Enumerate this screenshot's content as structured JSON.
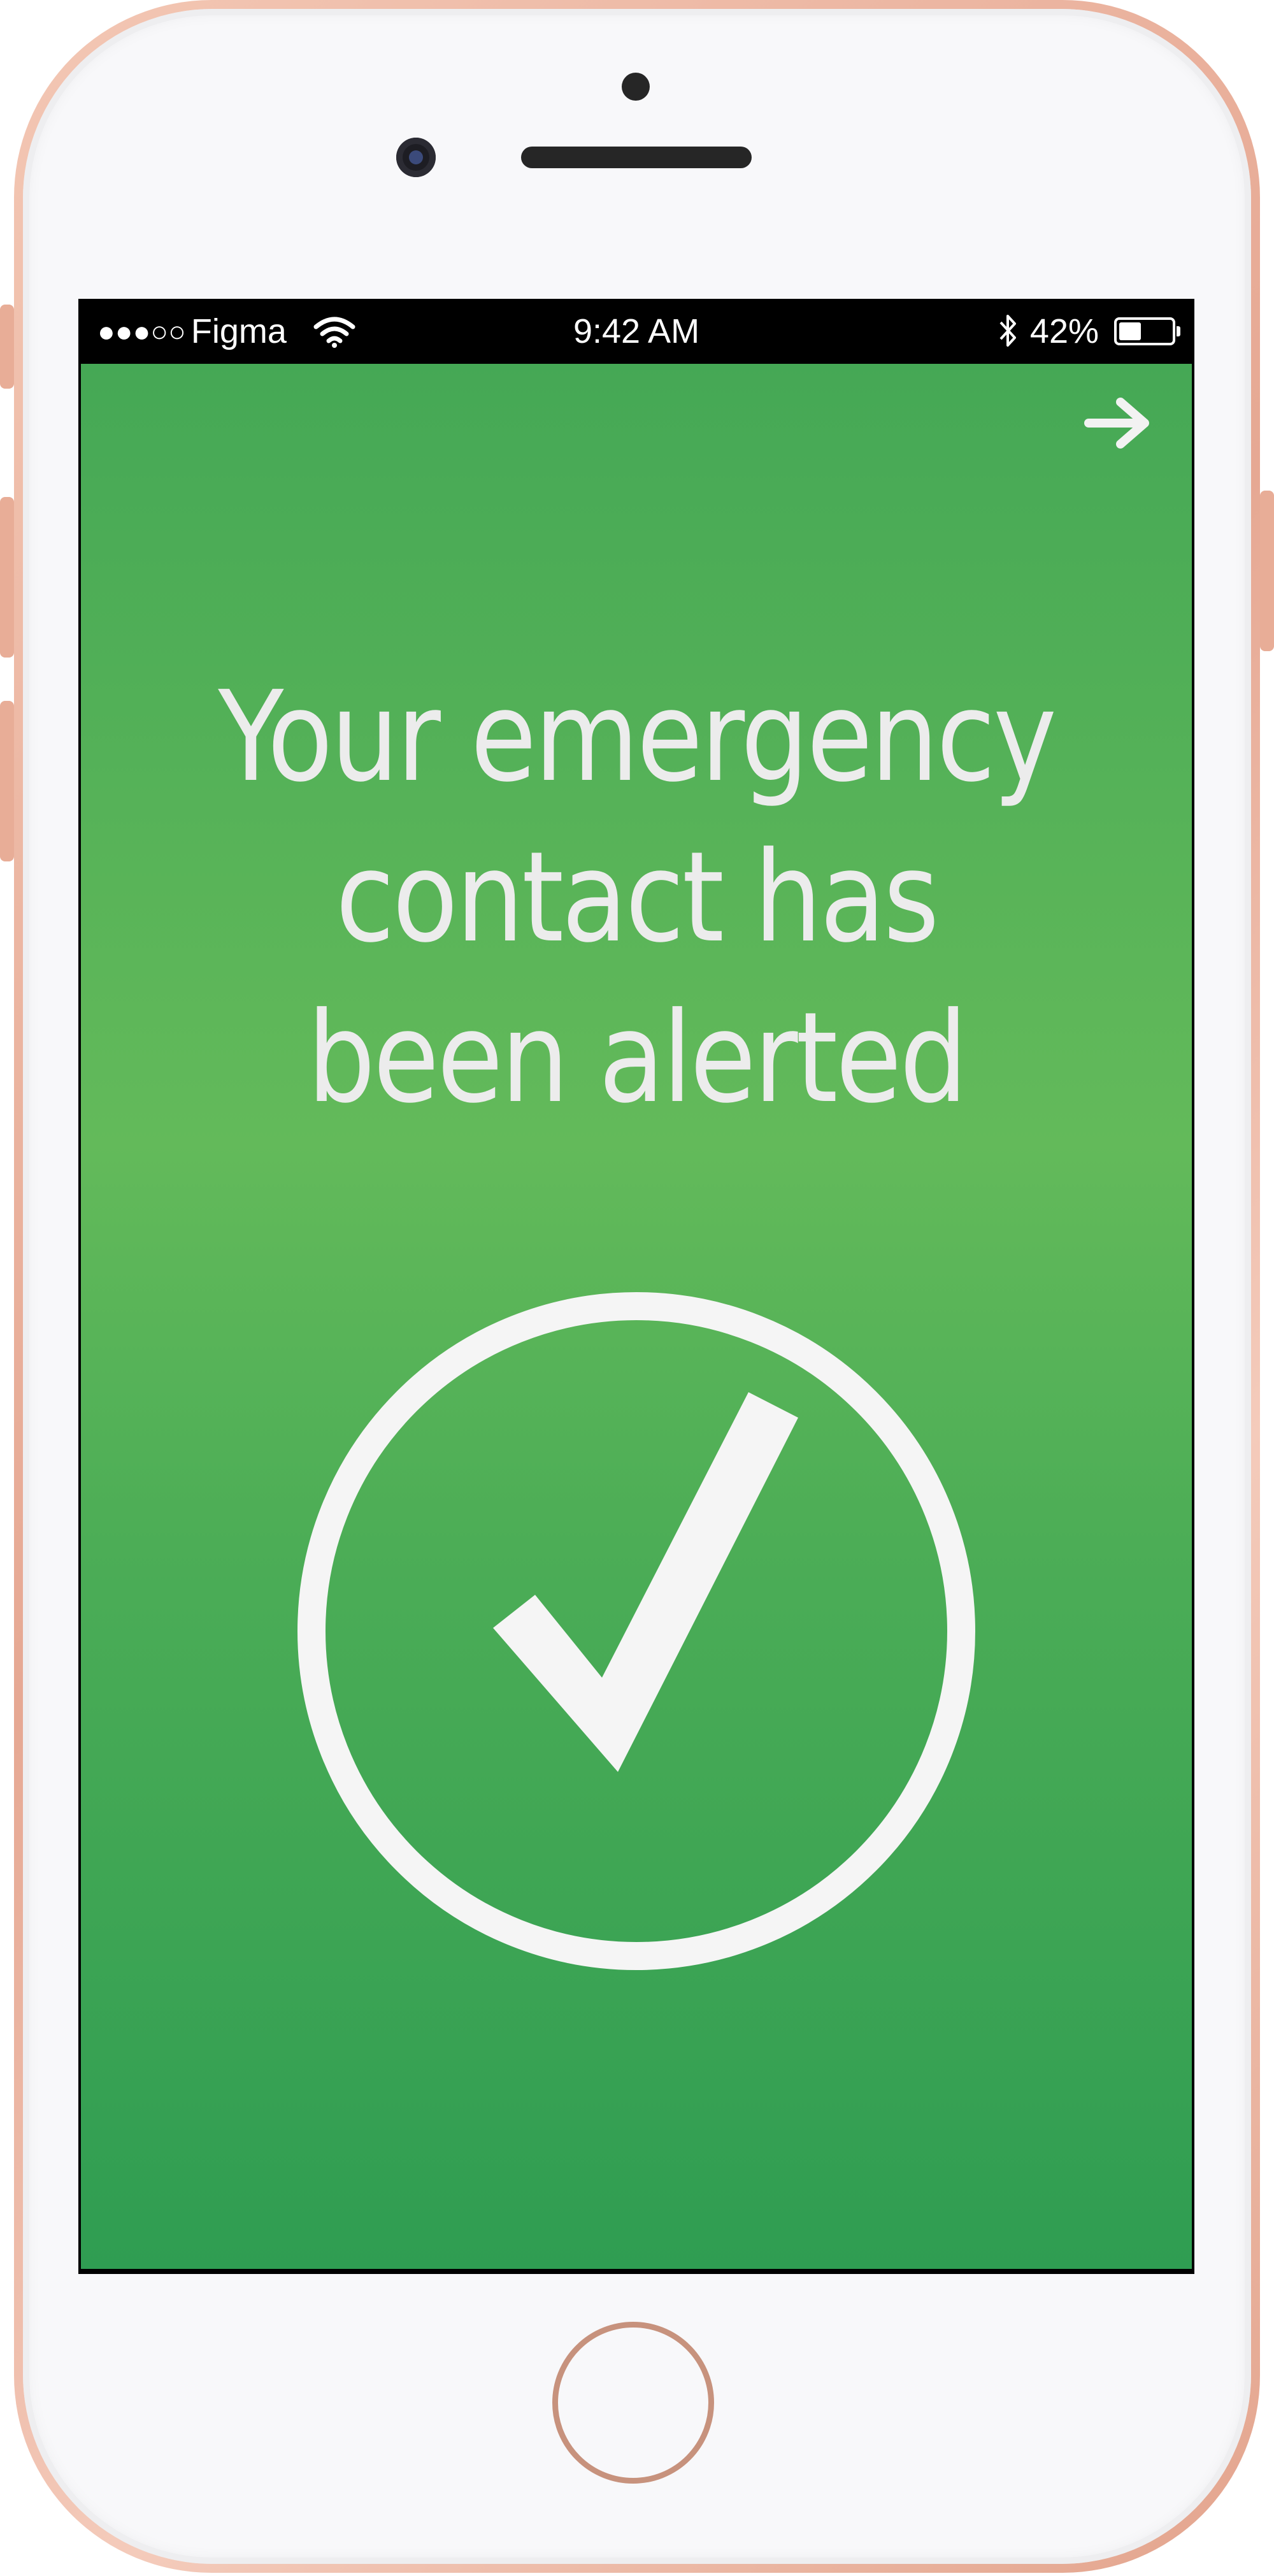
{
  "status_bar": {
    "signal": "●●●○○",
    "carrier": "Figma",
    "time": "9:42 AM",
    "battery_percent": "42%",
    "battery_level": 0.42
  },
  "screen": {
    "headline": "Your emergency contact has been alerted",
    "background_color_top": "#45a855",
    "background_color_bottom": "#2f9d52",
    "text_color": "#ececec"
  },
  "icons": {
    "next": "arrow-right-icon",
    "success": "checkmark-circle-icon"
  },
  "device": {
    "frame_color": "#e6a893"
  }
}
